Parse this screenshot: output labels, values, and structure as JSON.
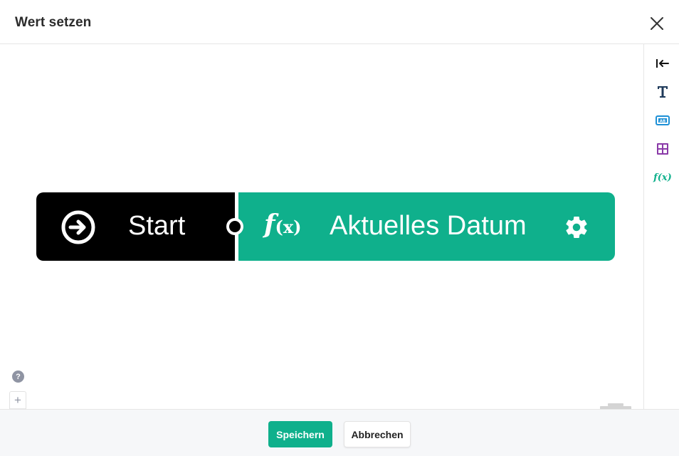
{
  "dialog": {
    "title": "Wert setzen"
  },
  "toolbox": {
    "items": [
      {
        "icon": "collapse-left-icon"
      },
      {
        "icon": "text-icon"
      },
      {
        "icon": "text-field-icon",
        "glyph": "AB"
      },
      {
        "icon": "grid-icon"
      },
      {
        "icon": "function-icon",
        "glyph": "f(x)"
      }
    ]
  },
  "workspace": {
    "start_block": {
      "label": "Start",
      "color": "#000000"
    },
    "function_block": {
      "glyph": "f",
      "glyph_args": "(x)",
      "label": "Aktuelles Datum",
      "color": "#0fb08c"
    }
  },
  "help": {
    "glyph": "?"
  },
  "zoom": {
    "in": "+",
    "reset": "○",
    "out": "−"
  },
  "footer": {
    "save_label": "Speichern",
    "cancel_label": "Abbrechen"
  },
  "colors": {
    "accent": "#0fb08c",
    "tool_text": "#1f3a5a",
    "tool_textfield": "#1e90d6",
    "tool_grid": "#8a3aa8",
    "tool_function": "#0fb08c"
  }
}
